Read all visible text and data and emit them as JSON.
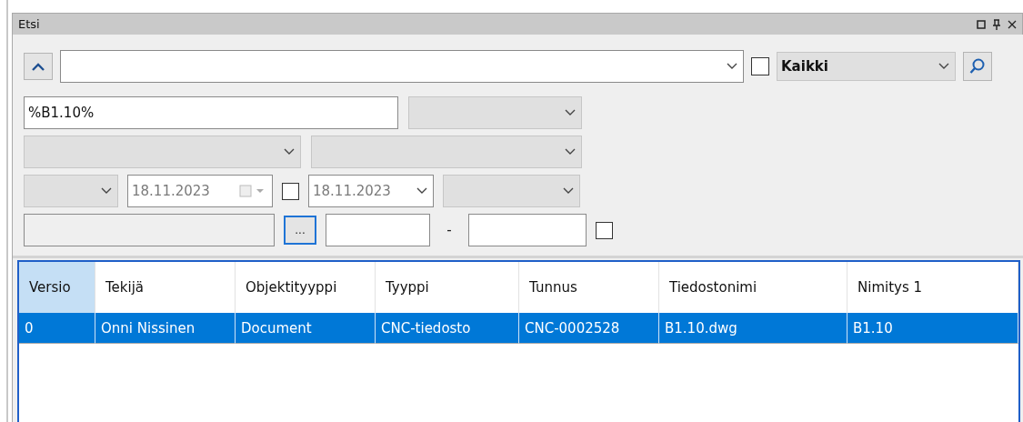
{
  "panel": {
    "title": "Etsi"
  },
  "toolbar": {
    "scope_checked": false,
    "scope": "Kaikki"
  },
  "filters": {
    "name_value": "%B1.10%",
    "date_from": "18.11.2023",
    "date_from_checked": false,
    "date_to": "18.11.2023",
    "browse_label": "...",
    "range_separator": "-",
    "range_checked": false
  },
  "table": {
    "columns": [
      {
        "label": "Versio",
        "selected": true
      },
      {
        "label": "Tekijä",
        "selected": false
      },
      {
        "label": "Objektityyppi",
        "selected": false
      },
      {
        "label": "Tyyppi",
        "selected": false
      },
      {
        "label": "Tunnus",
        "selected": false
      },
      {
        "label": "Tiedostonimi",
        "selected": false
      },
      {
        "label": "Nimitys 1",
        "selected": false
      }
    ],
    "rows": [
      {
        "selected": true,
        "cells": [
          "0",
          "Onni Nissinen",
          "Document",
          "CNC-tiedosto",
          "CNC-0002528",
          "B1.10.dwg",
          "B1.10"
        ]
      }
    ]
  }
}
